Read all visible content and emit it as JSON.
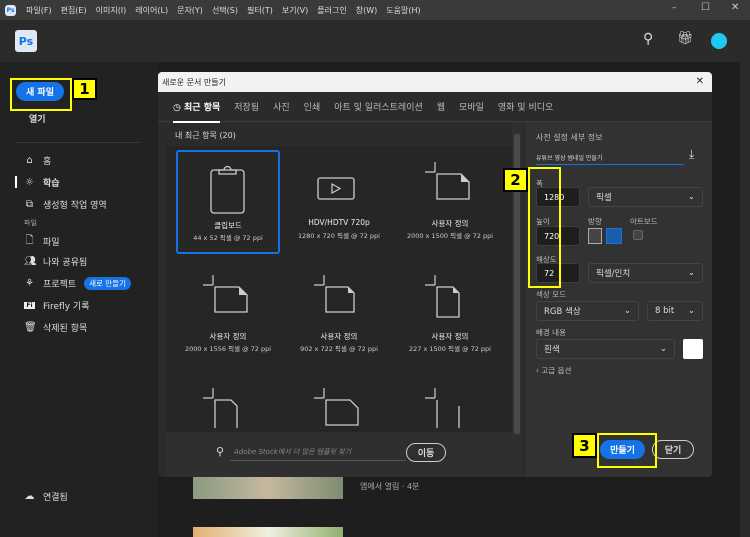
{
  "menu": [
    "파일(F)",
    "편집(E)",
    "이미지(I)",
    "레이어(L)",
    "문자(Y)",
    "선택(S)",
    "필터(T)",
    "보기(V)",
    "플러그인",
    "창(W)",
    "도움말(H)"
  ],
  "app": {
    "logo": "Ps"
  },
  "sidebar": {
    "new_file": "새 파일",
    "open": "열기",
    "items": [
      "홈",
      "학습",
      "생성형 작업 영역"
    ],
    "section": "파일",
    "file_items": [
      "파일",
      "나와 공유됨",
      "프로젝트",
      "Firefly 기록",
      "삭제된 항목"
    ],
    "new_badge": "새로 만들기",
    "connected": "연결됨"
  },
  "callouts": [
    "1",
    "2",
    "3"
  ],
  "dialog": {
    "title": "새로운 문서 만들기",
    "tabs": [
      "최근 항목",
      "저장됨",
      "사진",
      "인쇄",
      "아트 및 일러스트레이션",
      "웹",
      "모바일",
      "영화 및 비디오"
    ],
    "recent_label": "내 최근 항목",
    "recent_count": "(20)",
    "items": [
      {
        "name": "클립보드",
        "size": "44 x 52 픽셀 @ 72 ppi"
      },
      {
        "name": "HDV/HDTV 720p",
        "size": "1280 x 720 픽셀 @ 72 ppi"
      },
      {
        "name": "사용자 정의",
        "size": "2000 x 1500 픽셀 @ 72 ppi"
      },
      {
        "name": "사용자 정의",
        "size": "2000 x 1556 픽셀 @ 72 ppi"
      },
      {
        "name": "사용자 정의",
        "size": "902 x 722 픽셀 @ 72 ppi"
      },
      {
        "name": "사용자 정의",
        "size": "227 x 1500 픽셀 @ 72 ppi"
      }
    ],
    "stock_placeholder": "Adobe Stock에서 더 많은 템플릿 찾기",
    "go": "이동",
    "preset": {
      "header": "사전 설정 세부 정보",
      "name": "유튜브 영상 썸네일 만들기",
      "width_label": "폭",
      "width": "1280",
      "unit": "픽셀",
      "height_label": "높이",
      "height": "720",
      "orientation_label": "방향",
      "artboard_label": "아트보드",
      "resolution_label": "해상도",
      "resolution": "72",
      "res_unit": "픽셀/인치",
      "color_mode_label": "색상 모드",
      "color_mode": "RGB 색상",
      "bit": "8 bit",
      "bg_label": "배경 내용",
      "bg": "흰색",
      "bg_color": "#ffffff",
      "advanced": "고급 옵션"
    },
    "create": "만들기",
    "close": "닫기"
  },
  "background": {
    "caption": "앱에서 열림 · 4분"
  },
  "accent": "#1473e6"
}
